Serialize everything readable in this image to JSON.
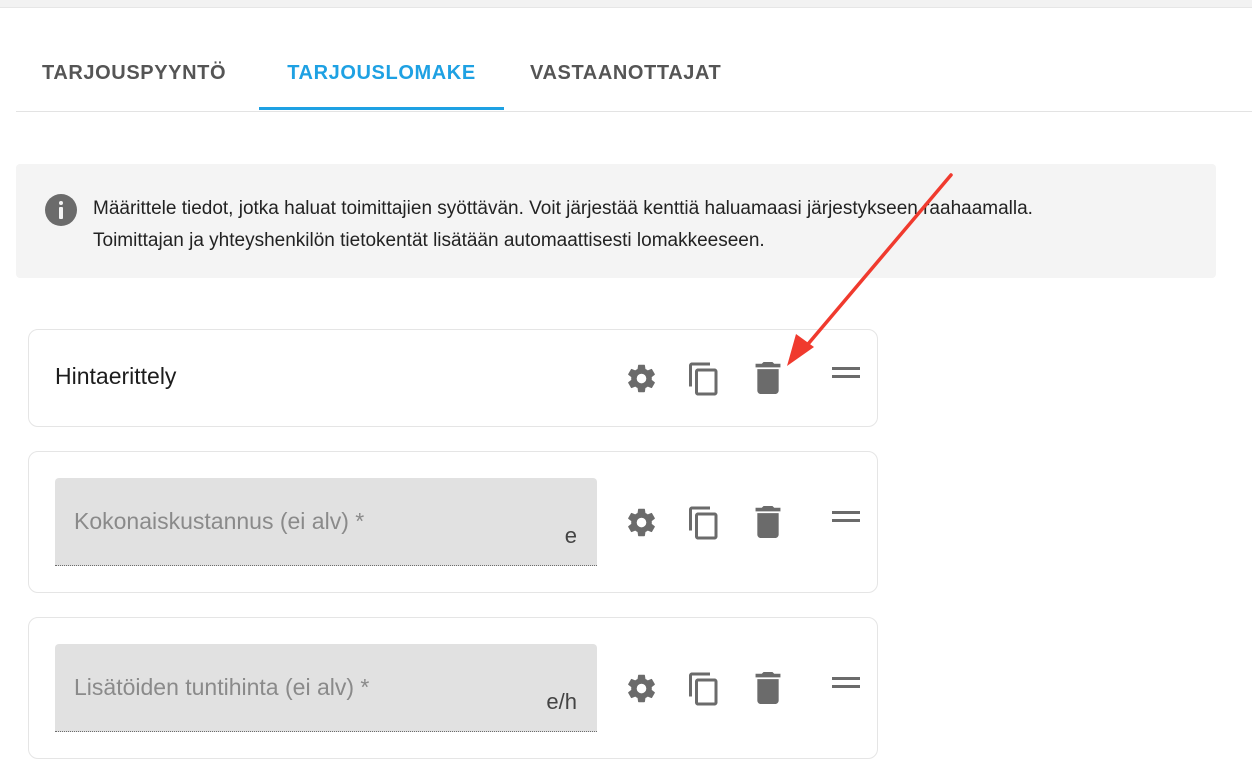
{
  "tabs": [
    {
      "label": "TARJOUSPYYNTÖ",
      "active": false
    },
    {
      "label": "TARJOUSLOMAKE",
      "active": true
    },
    {
      "label": "VASTAANOTTAJAT",
      "active": false
    }
  ],
  "info": {
    "icon": "info-icon",
    "lines": [
      "Määrittele tiedot, jotka haluat toimittajien syöttävän. Voit järjestää kenttiä haluamaasi järjestykseen raahaamalla.",
      "Toimittajan ja yhteyshenkilön tietokentät lisätään automaattisesti lomakkeeseen."
    ]
  },
  "cards": [
    {
      "title": "Hintaerittely"
    },
    {
      "placeholder": "Kokonaiskustannus (ei alv) *",
      "suffix": "e"
    },
    {
      "placeholder": "Lisätöiden tuntihinta (ei alv) *",
      "suffix": "e/h"
    }
  ],
  "card_actions": [
    "gear-icon",
    "copy-icon",
    "trash-icon",
    "drag-handle-icon"
  ],
  "colors": {
    "accent": "#1ea1e3",
    "annotation_arrow": "#f03a2e",
    "icon_gray": "#6b6b6b",
    "info_background": "#f4f4f4",
    "field_background": "#e1e1e1"
  }
}
